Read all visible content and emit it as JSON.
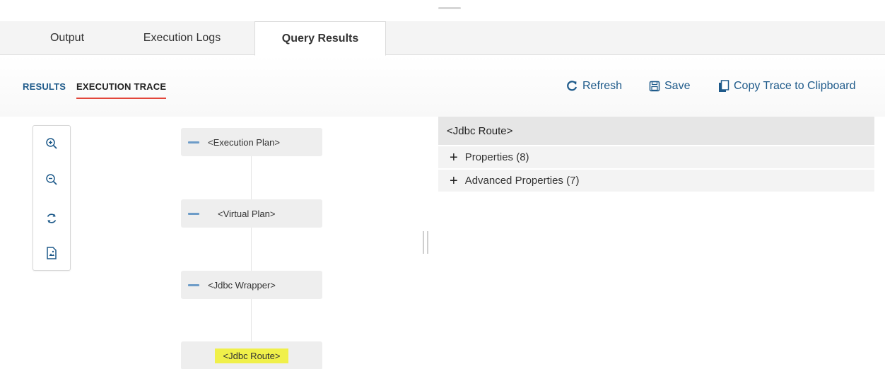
{
  "tabs": [
    {
      "label": "Output"
    },
    {
      "label": "Execution Logs"
    },
    {
      "label": "Query Results",
      "active": true
    }
  ],
  "subtabs": {
    "results": "RESULTS",
    "execution_trace": "EXECUTION TRACE"
  },
  "actions": {
    "refresh": "Refresh",
    "save": "Save",
    "copy_trace": "Copy Trace to Clipboard"
  },
  "zoom_toolbar": {
    "icons": [
      "zoom-in-icon",
      "zoom-out-icon",
      "refresh-icon",
      "export-image-icon"
    ]
  },
  "tree": {
    "nodes": [
      {
        "label": "<Execution Plan>",
        "collapsible": true
      },
      {
        "label": "<Virtual Plan>",
        "collapsible": true
      },
      {
        "label": "<Jdbc Wrapper>",
        "collapsible": true
      },
      {
        "label": "<Jdbc Route>",
        "collapsible": false,
        "selected": true
      }
    ]
  },
  "details": {
    "title": "<Jdbc Route>",
    "sections": [
      {
        "label": "Properties (8)"
      },
      {
        "label": "Advanced Properties (7)"
      }
    ]
  },
  "colors": {
    "accent_blue": "#1e5a8a",
    "active_underline": "#e2453a",
    "highlight": "#f0f04a",
    "collapse_bar": "#6d9cc8"
  }
}
